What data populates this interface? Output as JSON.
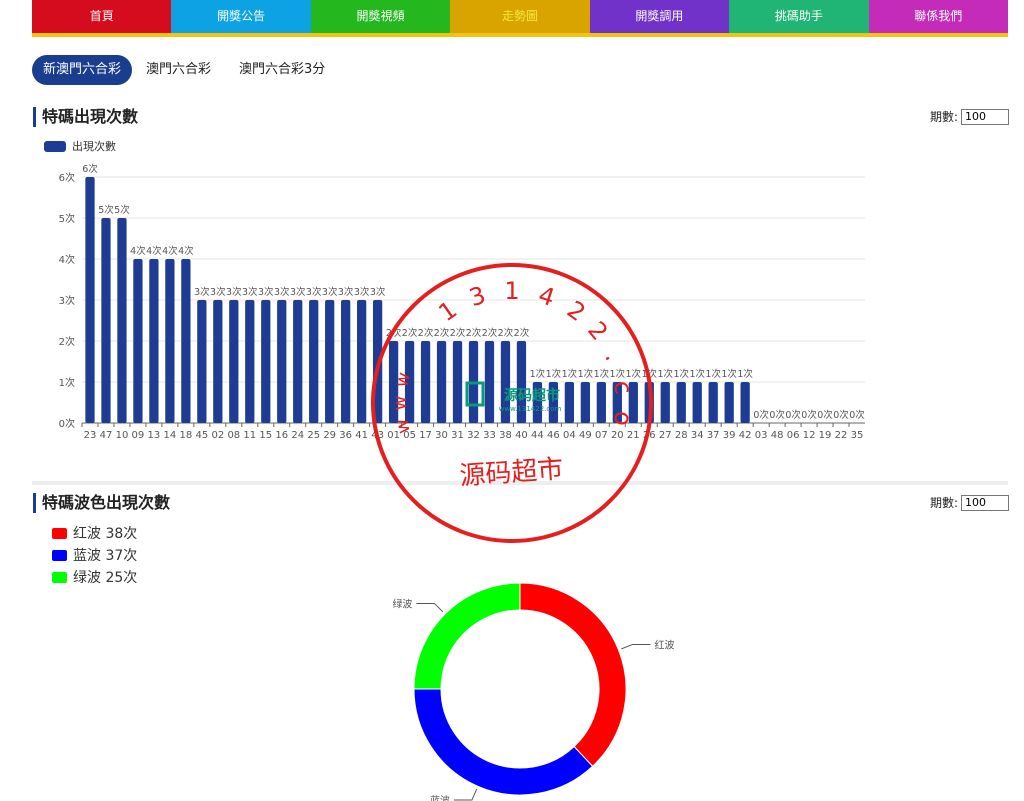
{
  "nav": [
    {
      "label": "首頁",
      "color": "#d50b1e",
      "text_color": "#ffffff"
    },
    {
      "label": "開獎公告",
      "color": "#0da2e4",
      "text_color": "#ffffff"
    },
    {
      "label": "開獎視頻",
      "color": "#24b81e",
      "text_color": "#ffffff"
    },
    {
      "label": "走勢圖",
      "color": "#d9a300",
      "text_color": "#f7e840"
    },
    {
      "label": "開獎調用",
      "color": "#7032c9",
      "text_color": "#ffffff"
    },
    {
      "label": "挑碼助手",
      "color": "#20b575",
      "text_color": "#ffffff"
    },
    {
      "label": "聯係我們",
      "color": "#c42bb9",
      "text_color": "#ffffff"
    }
  ],
  "tabs": [
    "新澳門六合彩",
    "澳門六合彩",
    "澳門六合彩3分"
  ],
  "section1": {
    "title": "特碼出現次數",
    "period_label": "期數:",
    "period_value": "100"
  },
  "section2": {
    "title": "特碼波色出現次數",
    "period_label": "期數:",
    "period_value": "100"
  },
  "stamp": {
    "ring_text": "1 3 1 4 2 2 . c o m",
    "url_prefix": "w w w",
    "bottom_text": "源码超市",
    "logo_text": "源码超市",
    "logo_url": "www.131422.com"
  },
  "chart_data": [
    {
      "type": "bar",
      "legend": "出現次數",
      "color": "#1f3c94",
      "categories": [
        "23",
        "47",
        "10",
        "09",
        "13",
        "14",
        "18",
        "45",
        "02",
        "08",
        "11",
        "15",
        "16",
        "24",
        "25",
        "29",
        "36",
        "41",
        "43",
        "01",
        "05",
        "17",
        "30",
        "31",
        "32",
        "33",
        "38",
        "40",
        "44",
        "46",
        "04",
        "49",
        "07",
        "20",
        "21",
        "26",
        "27",
        "28",
        "34",
        "37",
        "39",
        "42",
        "03",
        "48",
        "06",
        "12",
        "19",
        "22",
        "35"
      ],
      "values": [
        6,
        5,
        5,
        4,
        4,
        4,
        4,
        3,
        3,
        3,
        3,
        3,
        3,
        3,
        3,
        3,
        3,
        3,
        3,
        2,
        2,
        2,
        2,
        2,
        2,
        2,
        2,
        2,
        1,
        1,
        1,
        1,
        1,
        1,
        1,
        1,
        1,
        1,
        1,
        1,
        1,
        1,
        0,
        0,
        0,
        0,
        0,
        0,
        0
      ],
      "label_suffix": "次",
      "yticks": [
        "0次",
        "1次",
        "2次",
        "3次",
        "4次",
        "5次",
        "6次"
      ],
      "ylim": [
        0,
        6
      ]
    },
    {
      "type": "pie",
      "legend": [
        {
          "text": "红波 38次",
          "color": "#ff0000"
        },
        {
          "text": "蓝波 37次",
          "color": "#0000ff"
        },
        {
          "text": "绿波 25次",
          "color": "#00ff00"
        }
      ],
      "slices": [
        {
          "name": "红波",
          "value": 38,
          "color": "#ff0000"
        },
        {
          "name": "蓝波",
          "value": 37,
          "color": "#0000ff"
        },
        {
          "name": "绿波",
          "value": 25,
          "color": "#00ff00"
        }
      ]
    }
  ]
}
